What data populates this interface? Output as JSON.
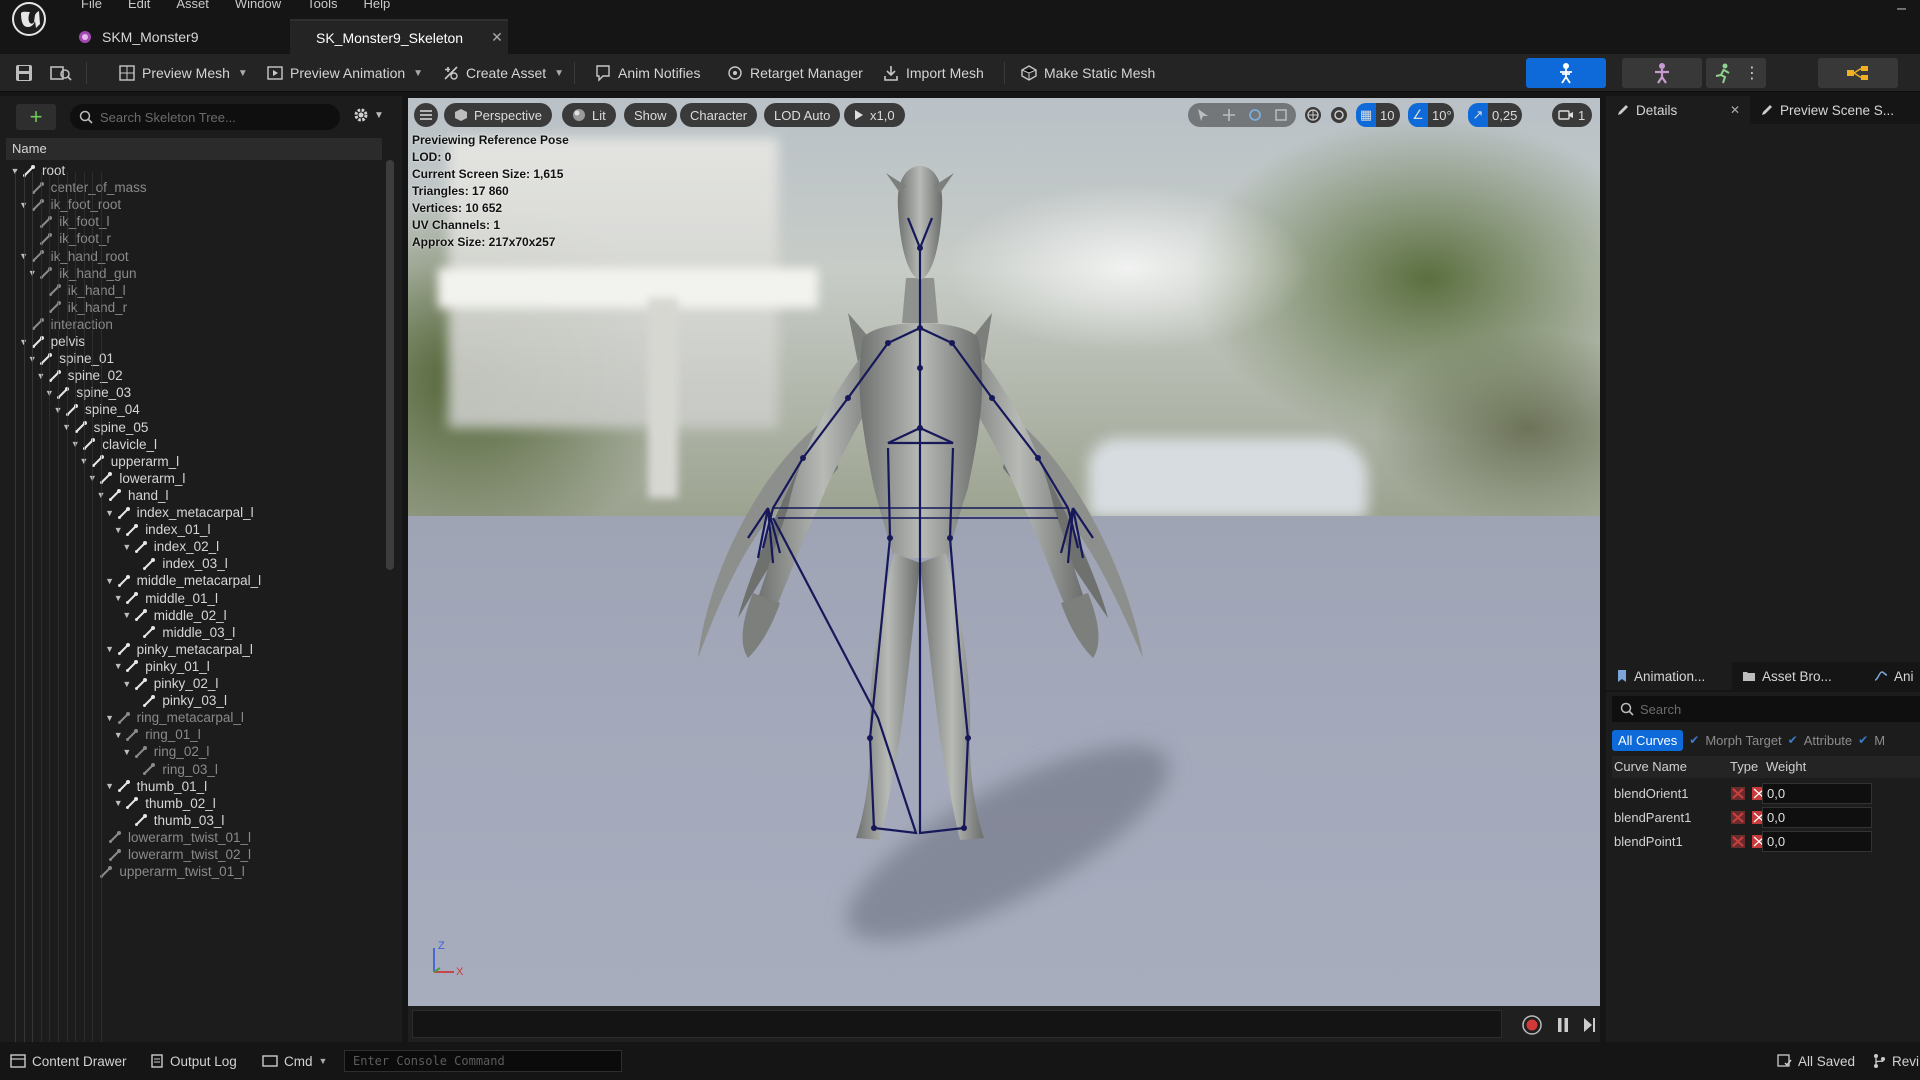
{
  "menu": [
    "File",
    "Edit",
    "Asset",
    "Window",
    "Tools",
    "Help"
  ],
  "tabs": [
    {
      "label": "SKM_Monster9",
      "icon": "skeletal-mesh-icon"
    },
    {
      "label": "SK_Monster9_Skeleton",
      "icon": "skeleton-icon",
      "active": true
    }
  ],
  "toolbar": {
    "preview_mesh": "Preview Mesh",
    "preview_animation": "Preview Animation",
    "create_asset": "Create Asset",
    "anim_notifies": "Anim Notifies",
    "retarget_manager": "Retarget Manager",
    "import_mesh": "Import Mesh",
    "make_static_mesh": "Make Static Mesh",
    "accent": "#0e6ad8"
  },
  "skeleton_tree": {
    "search_placeholder": "Search Skeleton Tree...",
    "column": "Name",
    "bones": [
      {
        "name": "root",
        "depth": 0,
        "expanded": true,
        "dim": false
      },
      {
        "name": "center_of_mass",
        "depth": 1,
        "expanded": null,
        "dim": true
      },
      {
        "name": "ik_foot_root",
        "depth": 1,
        "expanded": true,
        "dim": true
      },
      {
        "name": "ik_foot_l",
        "depth": 2,
        "expanded": null,
        "dim": true
      },
      {
        "name": "ik_foot_r",
        "depth": 2,
        "expanded": null,
        "dim": true
      },
      {
        "name": "ik_hand_root",
        "depth": 1,
        "expanded": true,
        "dim": true
      },
      {
        "name": "ik_hand_gun",
        "depth": 2,
        "expanded": true,
        "dim": true
      },
      {
        "name": "ik_hand_l",
        "depth": 3,
        "expanded": null,
        "dim": true
      },
      {
        "name": "ik_hand_r",
        "depth": 3,
        "expanded": null,
        "dim": true
      },
      {
        "name": "interaction",
        "depth": 1,
        "expanded": null,
        "dim": true
      },
      {
        "name": "pelvis",
        "depth": 1,
        "expanded": true,
        "dim": false
      },
      {
        "name": "spine_01",
        "depth": 2,
        "expanded": true,
        "dim": false
      },
      {
        "name": "spine_02",
        "depth": 3,
        "expanded": true,
        "dim": false
      },
      {
        "name": "spine_03",
        "depth": 4,
        "expanded": true,
        "dim": false
      },
      {
        "name": "spine_04",
        "depth": 5,
        "expanded": true,
        "dim": false
      },
      {
        "name": "spine_05",
        "depth": 6,
        "expanded": true,
        "dim": false
      },
      {
        "name": "clavicle_l",
        "depth": 7,
        "expanded": true,
        "dim": false
      },
      {
        "name": "upperarm_l",
        "depth": 8,
        "expanded": true,
        "dim": false
      },
      {
        "name": "lowerarm_l",
        "depth": 9,
        "expanded": true,
        "dim": false
      },
      {
        "name": "hand_l",
        "depth": 10,
        "expanded": true,
        "dim": false
      },
      {
        "name": "index_metacarpal_l",
        "depth": 11,
        "expanded": true,
        "dim": false
      },
      {
        "name": "index_01_l",
        "depth": 12,
        "expanded": true,
        "dim": false
      },
      {
        "name": "index_02_l",
        "depth": 13,
        "expanded": true,
        "dim": false
      },
      {
        "name": "index_03_l",
        "depth": 14,
        "expanded": null,
        "dim": false
      },
      {
        "name": "middle_metacarpal_l",
        "depth": 11,
        "expanded": true,
        "dim": false
      },
      {
        "name": "middle_01_l",
        "depth": 12,
        "expanded": true,
        "dim": false
      },
      {
        "name": "middle_02_l",
        "depth": 13,
        "expanded": true,
        "dim": false
      },
      {
        "name": "middle_03_l",
        "depth": 14,
        "expanded": null,
        "dim": false
      },
      {
        "name": "pinky_metacarpal_l",
        "depth": 11,
        "expanded": true,
        "dim": false
      },
      {
        "name": "pinky_01_l",
        "depth": 12,
        "expanded": true,
        "dim": false
      },
      {
        "name": "pinky_02_l",
        "depth": 13,
        "expanded": true,
        "dim": false
      },
      {
        "name": "pinky_03_l",
        "depth": 14,
        "expanded": null,
        "dim": false
      },
      {
        "name": "ring_metacarpal_l",
        "depth": 11,
        "expanded": true,
        "dim": true
      },
      {
        "name": "ring_01_l",
        "depth": 12,
        "expanded": true,
        "dim": true
      },
      {
        "name": "ring_02_l",
        "depth": 13,
        "expanded": true,
        "dim": true
      },
      {
        "name": "ring_03_l",
        "depth": 14,
        "expanded": null,
        "dim": true
      },
      {
        "name": "thumb_01_l",
        "depth": 11,
        "expanded": true,
        "dim": false
      },
      {
        "name": "thumb_02_l",
        "depth": 12,
        "expanded": true,
        "dim": false
      },
      {
        "name": "thumb_03_l",
        "depth": 13,
        "expanded": null,
        "dim": false
      },
      {
        "name": "lowerarm_twist_01_l",
        "depth": 10,
        "expanded": null,
        "dim": true
      },
      {
        "name": "lowerarm_twist_02_l",
        "depth": 10,
        "expanded": null,
        "dim": true
      },
      {
        "name": "upperarm_twist_01_l",
        "depth": 9,
        "expanded": null,
        "dim": true
      }
    ]
  },
  "viewport": {
    "perspective": "Perspective",
    "lit": "Lit",
    "show": "Show",
    "character": "Character",
    "lod": "LOD Auto",
    "play_rate": "x1,0",
    "grid_snap": "10",
    "rotation_snap": "10°",
    "scale_snap": "0,25",
    "camera_speed": "1",
    "stats": [
      "Previewing Reference Pose",
      "LOD: 0",
      "Current Screen Size: 1,615",
      "Triangles: 17 860",
      "Vertices: 10 652",
      "UV Channels: 1",
      "Approx Size: 217x70x257"
    ],
    "axis_z": "Z",
    "axis_x": "X"
  },
  "details": {
    "tab_details": "Details",
    "tab_preview_scene": "Preview Scene S..."
  },
  "anim_panel": {
    "tabs": [
      "Animation...",
      "Asset Bro...",
      "Ani"
    ],
    "search_placeholder": "Search",
    "filter_all": "All Curves",
    "filter_morph": "Morph Target",
    "filter_attribute": "Attribute",
    "filter_extra": "M",
    "col_name": "Curve Name",
    "col_type": "Type",
    "col_weight": "Weight",
    "curves": [
      {
        "name": "blendOrient1",
        "weight": "0,0"
      },
      {
        "name": "blendParent1",
        "weight": "0,0"
      },
      {
        "name": "blendPoint1",
        "weight": "0,0"
      }
    ]
  },
  "statusbar": {
    "content_drawer": "Content Drawer",
    "output_log": "Output Log",
    "cmd": "Cmd",
    "console_placeholder": "Enter Console Command",
    "all_saved": "All Saved",
    "revision": "Revi"
  }
}
